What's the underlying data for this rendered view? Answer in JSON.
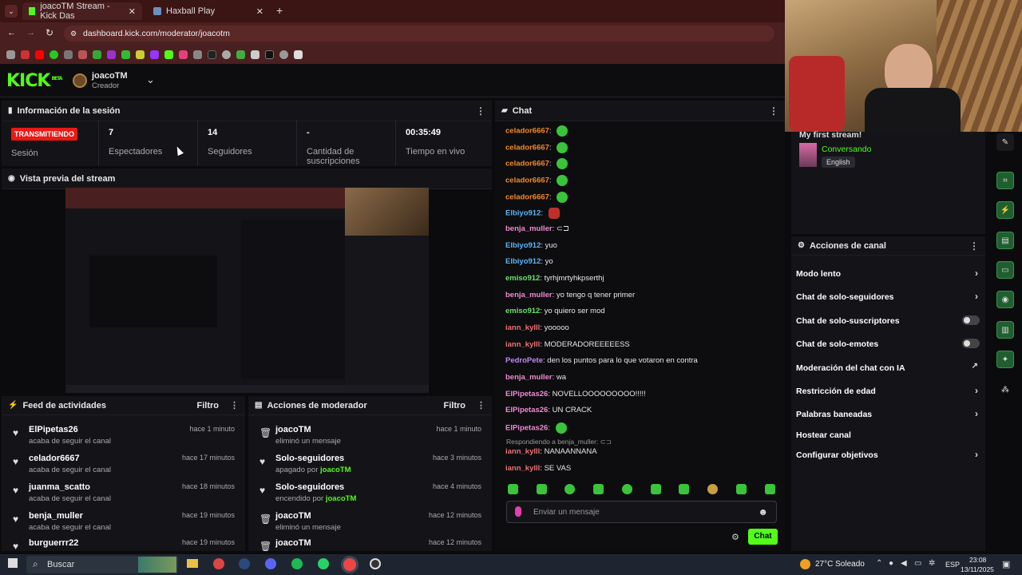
{
  "browser": {
    "tabs": [
      {
        "label": "joacoTM Stream - Kick Das"
      },
      {
        "label": "Haxball Play"
      }
    ],
    "url": "dashboard.kick.com/moderator/joacotm"
  },
  "header": {
    "logo": "KICK",
    "beta": "BETA",
    "channel": "joacoTM",
    "role": "Creador"
  },
  "session": {
    "title": "Información de la sesión",
    "status_badge": "TRANSMITIENDO",
    "status_label": "Sesión",
    "stats": [
      {
        "value": "7",
        "label": "Espectadores"
      },
      {
        "value": "14",
        "label": "Seguidores"
      },
      {
        "value": "-",
        "label": "Cantidad de suscripciones"
      },
      {
        "value": "00:35:49",
        "label": "Tiempo en vivo"
      }
    ]
  },
  "preview": {
    "title": "Vista previa del stream"
  },
  "feed": {
    "title": "Feed de actividades",
    "filter": "Filtro",
    "items": [
      {
        "name": "ElPipetas26",
        "text": "acaba de seguir el canal",
        "time": "hace 1 minuto"
      },
      {
        "name": "celador6667",
        "text": "acaba de seguir el canal",
        "time": "hace 17 minutos"
      },
      {
        "name": "juanma_scatto",
        "text": "acaba de seguir el canal",
        "time": "hace 18 minutos"
      },
      {
        "name": "benja_muller",
        "text": "acaba de seguir el canal",
        "time": "hace 19 minutos"
      },
      {
        "name": "burguerrr22",
        "text": "",
        "time": "hace 19 minutos"
      }
    ]
  },
  "modactions": {
    "title": "Acciones de moderador",
    "filter": "Filtro",
    "items": [
      {
        "name": "joacoTM",
        "text": "eliminó un mensaje",
        "time": "hace 1 minuto",
        "by": ""
      },
      {
        "name": "Solo-seguidores",
        "text": "apagado por ",
        "time": "hace 3 minutos",
        "by": "joacoTM"
      },
      {
        "name": "Solo-seguidores",
        "text": "encendido por ",
        "time": "hace 4 minutos",
        "by": "joacoTM"
      },
      {
        "name": "joacoTM",
        "text": "eliminó un mensaje",
        "time": "hace 12 minutos",
        "by": ""
      },
      {
        "name": "joacoTM",
        "text": "",
        "time": "hace 12 minutos",
        "by": ""
      }
    ]
  },
  "chat": {
    "title": "Chat",
    "messages": [
      {
        "user": "celador6667",
        "text": "",
        "color": "#f08a2a",
        "emote": true
      },
      {
        "user": "celador6667",
        "text": "",
        "color": "#f08a2a",
        "emote": true
      },
      {
        "user": "celador6667",
        "text": "",
        "color": "#f08a2a",
        "emote": true
      },
      {
        "user": "celador6667",
        "text": "",
        "color": "#f08a2a",
        "emote": true
      },
      {
        "user": "celador6667",
        "text": "",
        "color": "#f08a2a",
        "emote": true
      },
      {
        "user": "Elbiyo912",
        "text": "",
        "color": "#5ab4f0",
        "emote": true
      },
      {
        "user": "benja_muller",
        "text": "⊂⊐",
        "color": "#f08ad0",
        "emote": false
      },
      {
        "user": "Elbiyo912",
        "text": "yuo",
        "color": "#5ab4f0",
        "emote": false
      },
      {
        "user": "Elbiyo912",
        "text": "yo",
        "color": "#5ab4f0",
        "emote": false
      },
      {
        "user": "emiso912",
        "text": "tyrhjmrtyhkpserthj",
        "color": "#6ae06a",
        "emote": false
      },
      {
        "user": "benja_muller",
        "text": "yo tengo q tener primer",
        "color": "#f08ad0",
        "emote": false
      },
      {
        "user": "emiso912",
        "text": "yo quiero ser mod",
        "color": "#6ae06a",
        "emote": false
      },
      {
        "user": "iann_kylll",
        "text": "yooooo",
        "color": "#f07070",
        "emote": false
      },
      {
        "user": "iann_kylll",
        "text": "MODERADOREEEEESS",
        "color": "#f07070",
        "emote": false
      },
      {
        "user": "PedroPete",
        "text": "den los puntos para lo que votaron en contra",
        "color": "#c08af0",
        "emote": false
      },
      {
        "user": "benja_muller",
        "text": "wa",
        "color": "#f08ad0",
        "emote": false
      },
      {
        "user": "ElPipetas26",
        "text": "NOVELLOOOOOOOOO!!!!!",
        "color": "#f08ad0",
        "emote": false
      },
      {
        "user": "ElPipetas26",
        "text": "UN CRACK",
        "color": "#f08ad0",
        "emote": false
      },
      {
        "user": "ElPipetas26",
        "text": "",
        "color": "#f08ad0",
        "emote": true
      }
    ],
    "reply_note": "Respondiendo a benja_muller: ⊂⊐",
    "tail": [
      {
        "user": "iann_kylll",
        "text": "NANAANNANA",
        "color": "#f07070"
      },
      {
        "user": "iann_kylll",
        "text": "SE VAS",
        "color": "#f07070"
      }
    ],
    "input_placeholder": "Enviar un mensaje",
    "send_label": "Chat"
  },
  "stream_info": {
    "title": "My first stream!",
    "category": "Conversando",
    "language": "English"
  },
  "channel_actions": {
    "title": "Acciones de canal",
    "items": [
      {
        "label": "Modo lento",
        "control": "arrow"
      },
      {
        "label": "Chat de solo-seguidores",
        "control": "arrow"
      },
      {
        "label": "Chat de solo-suscriptores",
        "control": "toggle"
      },
      {
        "label": "Chat de solo-emotes",
        "control": "toggle"
      },
      {
        "label": "Moderación del chat con IA",
        "control": "external"
      },
      {
        "label": "Restricción de edad",
        "control": "arrow"
      },
      {
        "label": "Palabras baneadas",
        "control": "arrow"
      },
      {
        "label": "Hostear canal",
        "control": "none"
      },
      {
        "label": "Configurar objetivos",
        "control": "arrow"
      }
    ]
  },
  "taskbar": {
    "search": "Buscar",
    "weather": "27°C Soleado",
    "lang": "ESP",
    "time": "23:08",
    "date": "13/11/2025"
  },
  "colors": {
    "accent": "#53fc18",
    "live": "#e91916",
    "bg": "#0b0b0d"
  }
}
